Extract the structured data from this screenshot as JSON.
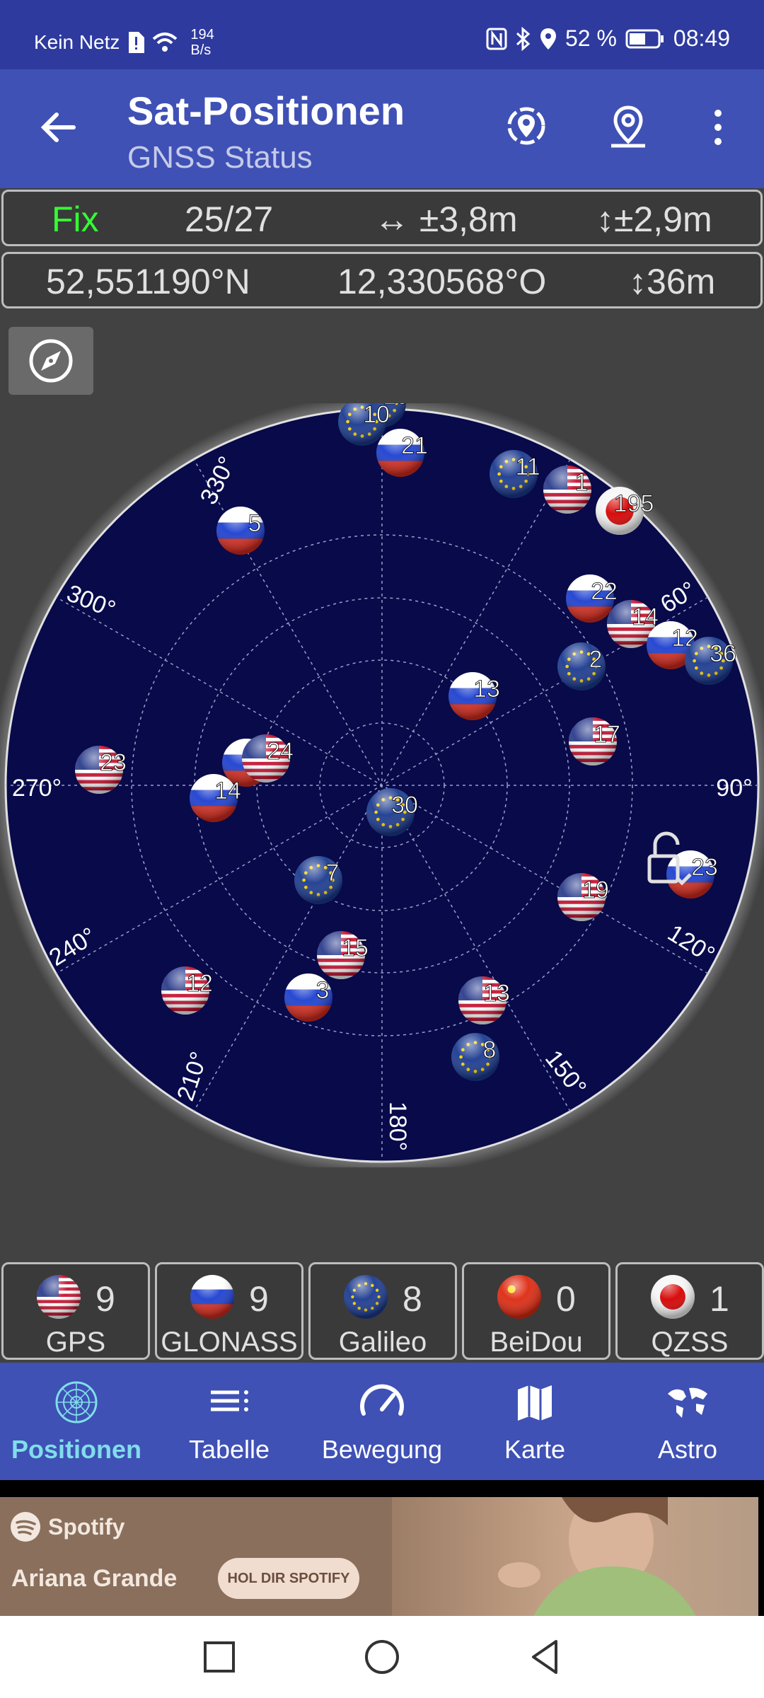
{
  "status_bar": {
    "carrier": "Kein Netz",
    "net_speed_value": "194",
    "net_speed_unit": "B/s",
    "battery": "52 %",
    "time": "08:49"
  },
  "app_bar": {
    "title": "Sat-Positionen",
    "subtitle": "GNSS Status"
  },
  "fix_row": {
    "fix": "Fix",
    "sats": "25/27",
    "h_acc": "↔ ±3,8m",
    "v_acc": "↕±2,9m"
  },
  "coord_row": {
    "lat": "52,551190°N",
    "lon": "12,330568°O",
    "alt": "↕36m"
  },
  "sky": {
    "directions": [
      "330°",
      "300°",
      "60°",
      "270°",
      "90°",
      "240°",
      "120°",
      "210°",
      "150°",
      "180°"
    ],
    "satellites": [
      {
        "id": "19",
        "type": "galileo"
      },
      {
        "id": "10",
        "type": "galileo"
      },
      {
        "id": "21",
        "type": "glonass"
      },
      {
        "id": "11",
        "type": "galileo"
      },
      {
        "id": "1",
        "type": "gps"
      },
      {
        "id": "195",
        "type": "qzss"
      },
      {
        "id": "5",
        "type": "glonass"
      },
      {
        "id": "22",
        "type": "glonass"
      },
      {
        "id": "14",
        "type": "gps"
      },
      {
        "id": "12",
        "type": "glonass"
      },
      {
        "id": "36",
        "type": "galileo"
      },
      {
        "id": "2",
        "type": "galileo"
      },
      {
        "id": "13",
        "type": "glonass"
      },
      {
        "id": "17",
        "type": "gps"
      },
      {
        "id": "23",
        "type": "gps"
      },
      {
        "id": "4",
        "type": "glonass"
      },
      {
        "id": "24",
        "type": "gps"
      },
      {
        "id": "14",
        "type": "glonass"
      },
      {
        "id": "30",
        "type": "galileo"
      },
      {
        "id": "7",
        "type": "galileo"
      },
      {
        "id": "23",
        "type": "glonass"
      },
      {
        "id": "19",
        "type": "gps"
      },
      {
        "id": "15",
        "type": "gps"
      },
      {
        "id": "12",
        "type": "gps"
      },
      {
        "id": "3",
        "type": "glonass"
      },
      {
        "id": "13",
        "type": "gps"
      },
      {
        "id": "8",
        "type": "galileo"
      }
    ]
  },
  "constellations": [
    {
      "name": "GPS",
      "count": "9",
      "type": "gps"
    },
    {
      "name": "GLONASS",
      "count": "9",
      "type": "glonass"
    },
    {
      "name": "Galileo",
      "count": "8",
      "type": "galileo"
    },
    {
      "name": "BeiDou",
      "count": "0",
      "type": "beidou"
    },
    {
      "name": "QZSS",
      "count": "1",
      "type": "qzss"
    }
  ],
  "nav": [
    {
      "label": "Positionen",
      "icon": "radar-icon",
      "active": true
    },
    {
      "label": "Tabelle",
      "icon": "list-icon"
    },
    {
      "label": "Bewegung",
      "icon": "speedometer-icon"
    },
    {
      "label": "Karte",
      "icon": "map-icon"
    },
    {
      "label": "Astro",
      "icon": "world-icon"
    }
  ],
  "ad": {
    "brand": "Spotify",
    "artist": "Ariana Grande",
    "cta": "HOL DIR SPOTIFY"
  },
  "colors": {
    "statusbar": "#2e3a9e",
    "appbar": "#3f51b5",
    "sky": "#080a4a",
    "fix": "#33ff33",
    "active_nav": "#80deea"
  }
}
